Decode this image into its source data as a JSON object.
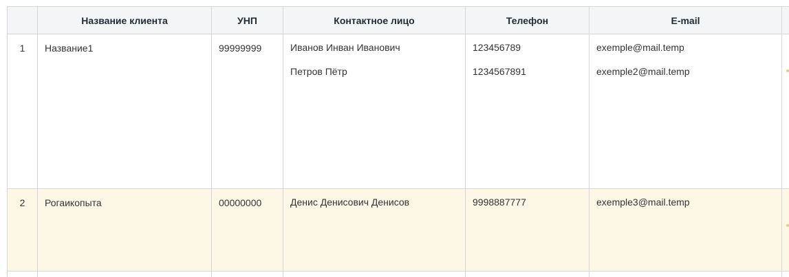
{
  "table": {
    "headers": [
      "",
      "Название клиента",
      "УНП",
      "Контактное лицо",
      "Телефон",
      "E-mail"
    ],
    "rows": [
      {
        "num": "1",
        "client": "Название1",
        "unp": "99999999",
        "contacts": [
          "Иванов Инван Иванович",
          "Петров Пётр"
        ],
        "phones": [
          "123456789",
          "1234567891"
        ],
        "emails": [
          "exemple@mail.temp",
          "exemple2@mail.temp"
        ]
      },
      {
        "num": "2",
        "client": "Рогаикопыта",
        "unp": "00000000",
        "contacts": [
          "Денис Денисович Денисов"
        ],
        "phones": [
          "9998887777"
        ],
        "emails": [
          "exemple3@mail.temp"
        ]
      }
    ]
  },
  "colors": {
    "header_bg": "#f4f5f7",
    "highlight_row_bg": "#fdf8e6",
    "border": "#d4d7dd"
  }
}
